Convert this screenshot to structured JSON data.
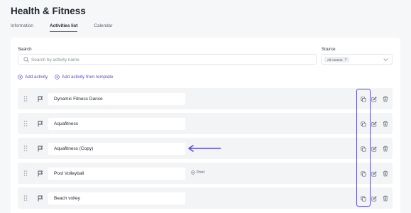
{
  "page": {
    "title": "Health & Fitness"
  },
  "tabs": [
    {
      "label": "Information",
      "active": false
    },
    {
      "label": "Activities list",
      "active": true
    },
    {
      "label": "Calendar",
      "active": false
    }
  ],
  "search": {
    "label": "Search",
    "placeholder": "Search by activity name",
    "value": ""
  },
  "source": {
    "label": "Source",
    "selected_chip": "All content"
  },
  "actions": {
    "add_activity": "Add activity",
    "add_from_template": "Add activity from template"
  },
  "activities": [
    {
      "name": "Dynamic Fitness Dance",
      "tag": ""
    },
    {
      "name": "Aquafitness",
      "tag": ""
    },
    {
      "name": "Aquafitness (Copy)",
      "tag": ""
    },
    {
      "name": "Pool Volleyball",
      "tag": "Pool"
    },
    {
      "name": "Beach volley",
      "tag": ""
    }
  ],
  "icons": {
    "search": "search-icon",
    "plus": "plus-circle-icon",
    "drag": "drag-handle-icon",
    "flag": "flag-icon",
    "duplicate": "duplicate-icon",
    "edit": "edit-icon",
    "delete": "trash-icon",
    "chevron": "chevron-down-icon",
    "tag": "tag-icon"
  },
  "colors": {
    "accent": "#5a4bd6",
    "background": "#f6f7f9",
    "row_background": "#f3f4f6"
  }
}
